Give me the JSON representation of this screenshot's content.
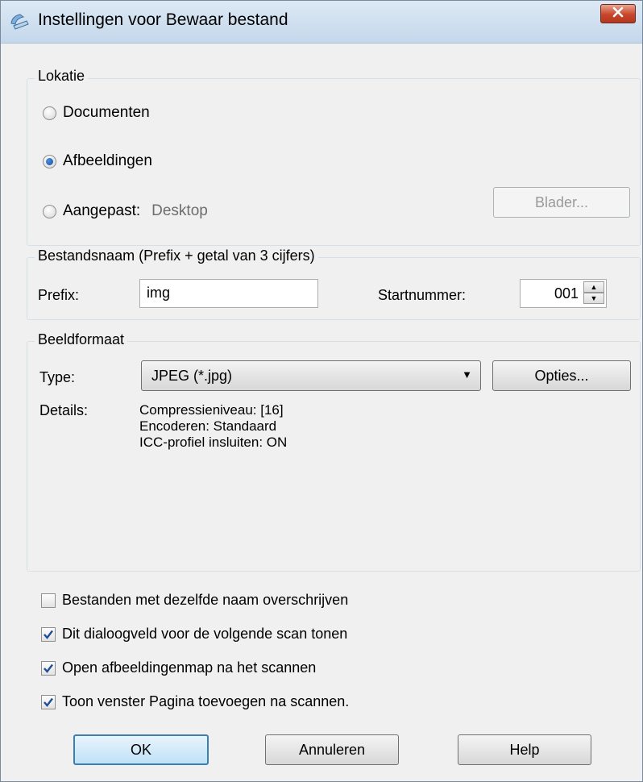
{
  "window": {
    "title": "Instellingen voor Bewaar bestand",
    "icon": "scanner-app-icon",
    "close_icon": "close-icon"
  },
  "location": {
    "legend": "Lokatie",
    "options": [
      {
        "label": "Documenten",
        "checked": false
      },
      {
        "label": "Afbeeldingen",
        "checked": true
      },
      {
        "label": "Aangepast:",
        "checked": false
      }
    ],
    "custom_path": "Desktop",
    "browse_button": "Blader..."
  },
  "filename": {
    "legend": "Bestandsnaam (Prefix + getal van 3 cijfers)",
    "prefix_label": "Prefix:",
    "prefix_value": "img",
    "start_label": "Startnummer:",
    "start_value": "001"
  },
  "format": {
    "legend": "Beeldformaat",
    "type_label": "Type:",
    "type_value": "JPEG (*.jpg)",
    "options_button": "Opties...",
    "details_label": "Details:",
    "details_lines": [
      "Compressieniveau: [16]",
      "Encoderen: Standaard",
      "ICC-profiel insluiten: ON"
    ]
  },
  "checkboxes": [
    {
      "label": "Bestanden met dezelfde naam overschrijven",
      "checked": false
    },
    {
      "label": "Dit dialoogveld voor de volgende scan tonen",
      "checked": true
    },
    {
      "label": "Open afbeeldingenmap na het scannen",
      "checked": true
    },
    {
      "label": "Toon venster Pagina toevoegen na scannen.",
      "checked": true
    }
  ],
  "buttons": {
    "ok": "OK",
    "cancel": "Annuleren",
    "help": "Help"
  },
  "colors": {
    "check": "#1f4e99",
    "close_button": "#c8452a",
    "default_button_border": "#3c7fb1"
  }
}
